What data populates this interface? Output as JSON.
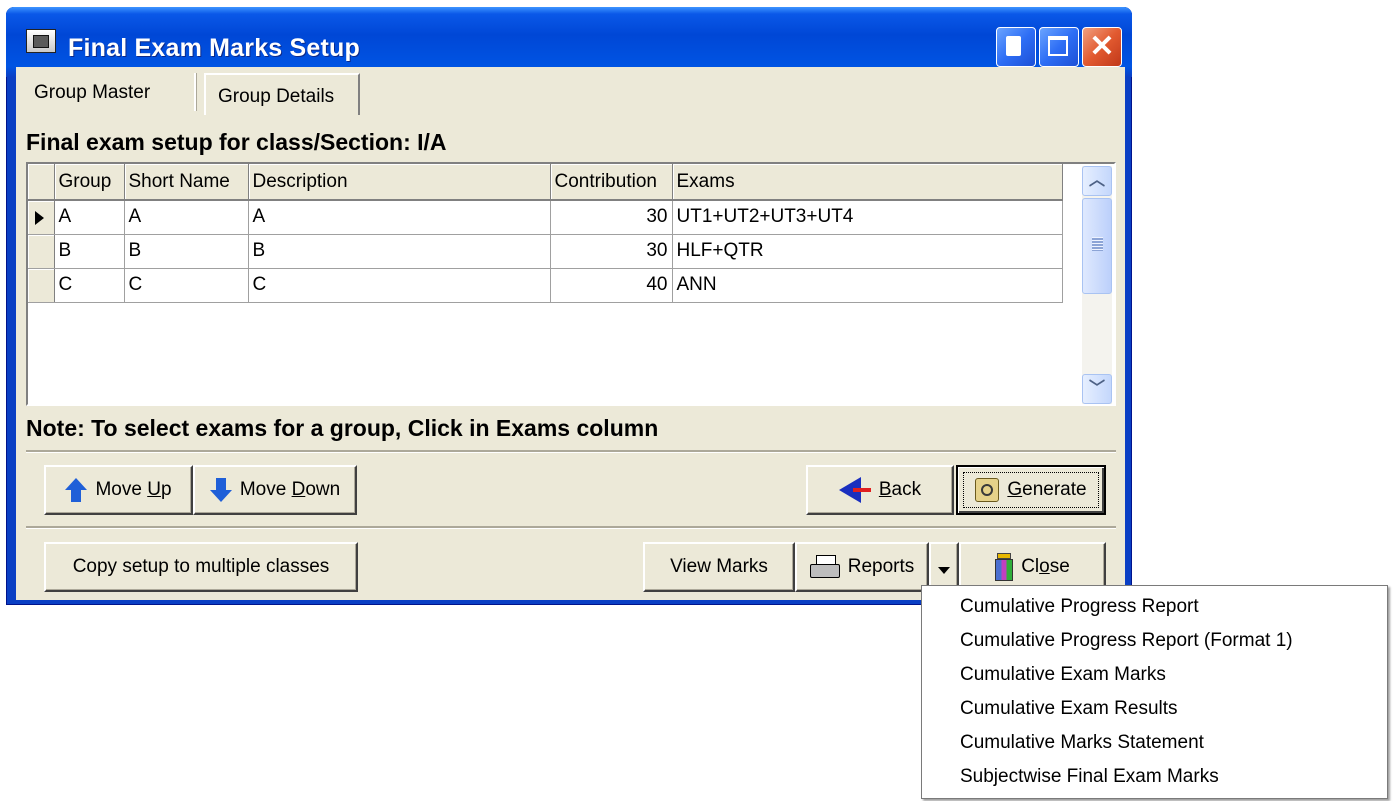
{
  "window": {
    "title": "Final Exam Marks Setup"
  },
  "tabs": [
    {
      "label": "Group Master"
    },
    {
      "label": "Group Details"
    }
  ],
  "heading": "Final exam setup for class/Section: I/A",
  "grid": {
    "columns": [
      "Group",
      "Short Name",
      "Description",
      "Contribution",
      "Exams"
    ],
    "rows": [
      {
        "group": "A",
        "short_name": "A",
        "description": "A",
        "contribution": "30",
        "exams": "UT1+UT2+UT3+UT4"
      },
      {
        "group": "B",
        "short_name": "B",
        "description": "B",
        "contribution": "30",
        "exams": "HLF+QTR"
      },
      {
        "group": "C",
        "short_name": "C",
        "description": "C",
        "contribution": "40",
        "exams": "ANN"
      }
    ]
  },
  "note": "Note: To select exams for a group, Click in Exams column",
  "buttons": {
    "move_up": {
      "pre": "Move ",
      "key": "U",
      "post": "p"
    },
    "move_down": {
      "pre": "Move ",
      "key": "D",
      "post": "own"
    },
    "back": {
      "pre": "",
      "key": "B",
      "post": "ack"
    },
    "generate": {
      "pre": "",
      "key": "G",
      "post": "enerate"
    },
    "copy_setup": "Copy setup to multiple classes",
    "view_marks": "View Marks",
    "reports": "Reports",
    "close": {
      "pre": "Cl",
      "key": "o",
      "post": "se"
    }
  },
  "reports_menu": [
    "Cumulative Progress Report",
    "Cumulative Progress Report (Format 1)",
    "Cumulative Exam Marks",
    "Cumulative Exam Results",
    "Cumulative Marks Statement",
    "Subjectwise Final Exam Marks"
  ],
  "icons": {
    "title_icon": "app-window-icon",
    "move_up": "arrow-up-icon",
    "move_down": "arrow-down-icon",
    "back": "back-arrow-icon",
    "generate": "generate-icon",
    "reports": "printer-icon",
    "close": "exit-door-icon"
  },
  "colors": {
    "titlebar": "#0054e3",
    "client": "#ece9d8",
    "close_button": "#e25a30"
  }
}
